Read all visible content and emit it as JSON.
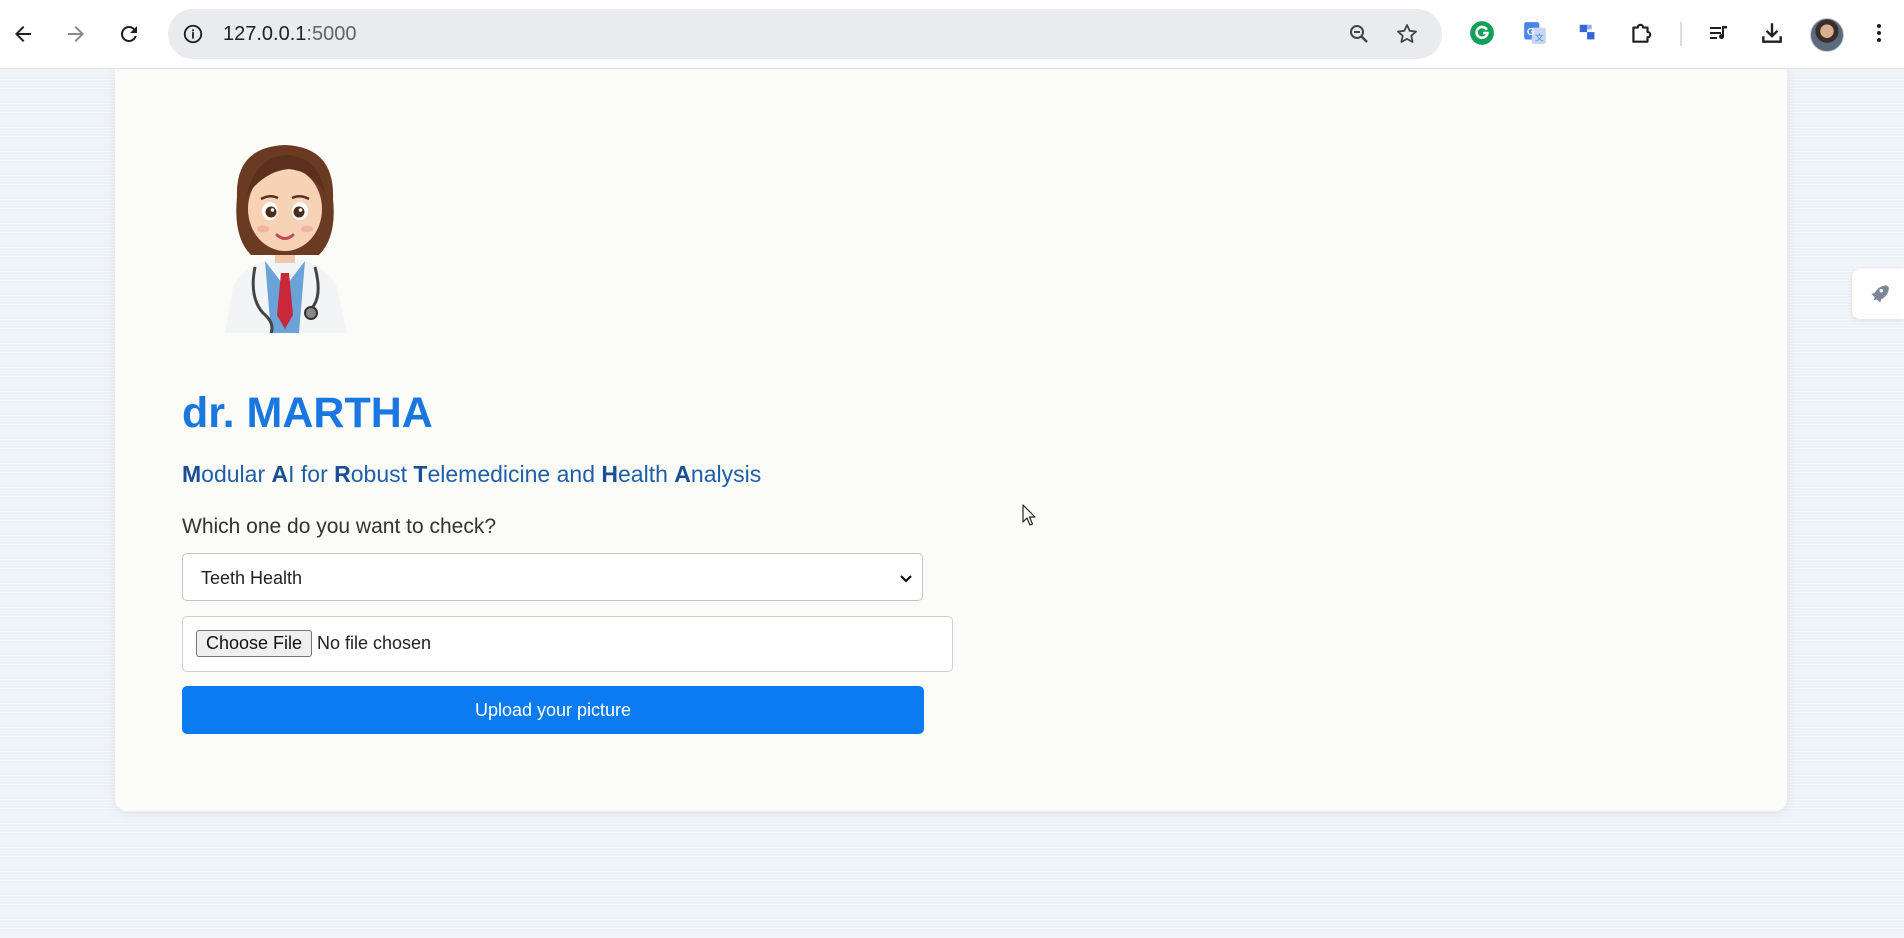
{
  "browser": {
    "url_host": "127.0.0.1",
    "url_port": ":5000",
    "icons": [
      "back-arrow-icon",
      "forward-arrow-icon",
      "reload-icon",
      "info-icon",
      "zoom-icon",
      "star-icon",
      "grammarly-icon",
      "google-translate-icon",
      "extension-icon",
      "puzzle-icon",
      "media-icon",
      "download-icon",
      "profile-avatar",
      "menu-icon"
    ]
  },
  "page": {
    "title": "dr. MARTHA",
    "subtitle_parts": [
      {
        "bold": "M",
        "rest": "odular "
      },
      {
        "bold": "A",
        "rest": "I for "
      },
      {
        "bold": "R",
        "rest": "obust "
      },
      {
        "bold": "T",
        "rest": "elemedicine and "
      },
      {
        "bold": "H",
        "rest": "ealth "
      },
      {
        "bold": "A",
        "rest": "nalysis"
      }
    ],
    "question": "Which one do you want to check?",
    "select": {
      "value": "Teeth Health"
    },
    "file_input": {
      "button_label": "Choose File",
      "status": "No file chosen"
    },
    "upload_label": "Upload your picture"
  },
  "colors": {
    "accent": "#1a77e0",
    "button": "#0b7bf2",
    "subtitle": "#1f5fa8"
  }
}
